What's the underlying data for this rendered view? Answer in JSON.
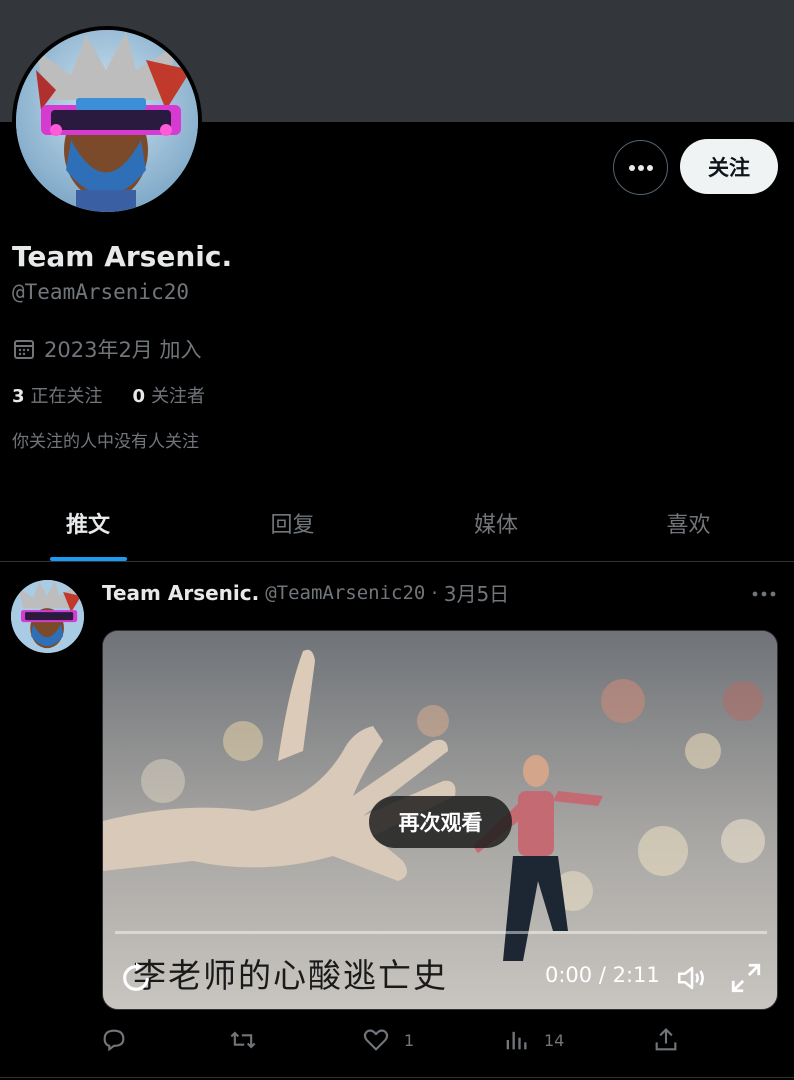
{
  "profile": {
    "name": "Team Arsenic.",
    "handle": "@TeamArsenic20",
    "joined": "2023年2月 加入",
    "following_count": "3",
    "following_label": "正在关注",
    "followers_count": "0",
    "followers_label": "关注者",
    "followers_you_know": "你关注的人中没有人关注"
  },
  "actions": {
    "follow_label": "关注"
  },
  "tabs": [
    {
      "label": "推文",
      "active": true
    },
    {
      "label": "回复",
      "active": false
    },
    {
      "label": "媒体",
      "active": false
    },
    {
      "label": "喜欢",
      "active": false
    }
  ],
  "post": {
    "name": "Team Arsenic.",
    "handle": "@TeamArsenic20",
    "separator": "·",
    "date": "3月5日",
    "video": {
      "replay_label": "再次观看",
      "caption": "李老师的心酸逃亡史",
      "timecode": "0:00 / 2:11"
    },
    "engagement": {
      "likes": "1",
      "views": "14"
    }
  },
  "colors": {
    "accent": "#1d9bf0",
    "background": "#000000",
    "banner": "#33363a",
    "muted_text": "#71767b"
  }
}
